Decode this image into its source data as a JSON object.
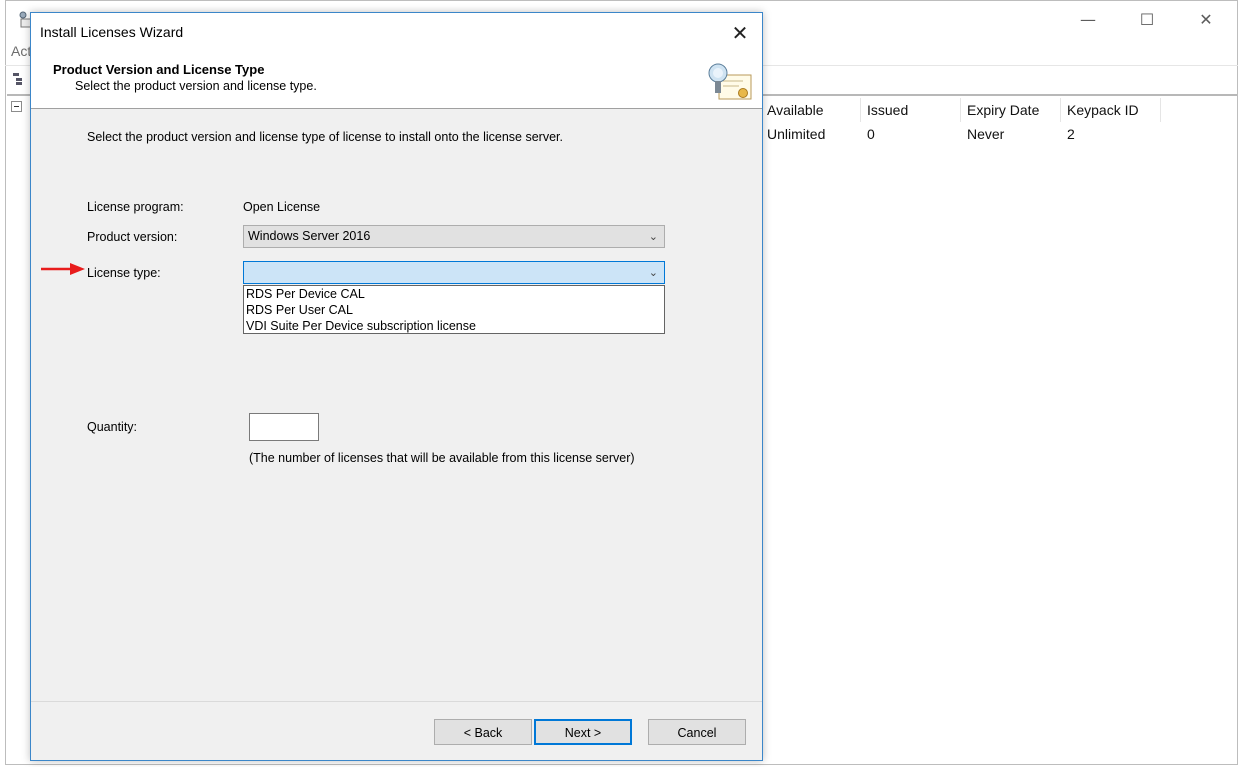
{
  "background_window": {
    "menu_partial": "Act",
    "controls": {
      "minimize": "—",
      "maximize": "☐",
      "close": "✕"
    },
    "columns": [
      "Available",
      "Issued",
      "Expiry Date",
      "Keypack ID"
    ],
    "row": [
      "Unlimited",
      "0",
      "Never",
      "2"
    ]
  },
  "dialog": {
    "title": "Install Licenses Wizard",
    "close_glyph": "✕",
    "header": {
      "title": "Product Version and License Type",
      "subtitle": "Select the product version and license type."
    },
    "intro": "Select the product version and license type of license to install onto the license server.",
    "fields": {
      "program_label": "License program:",
      "program_value": "Open License",
      "version_label": "Product version:",
      "version_value": "Windows Server 2016",
      "type_label": "License type:",
      "type_value": "",
      "type_options": [
        "RDS Per Device CAL",
        "RDS Per User CAL",
        "VDI Suite Per Device subscription license"
      ],
      "quantity_label": "Quantity:",
      "quantity_value": "",
      "quantity_note": "(The number of licenses that will be available from this license server)"
    },
    "buttons": {
      "back": "< Back",
      "next": "Next >",
      "cancel": "Cancel"
    }
  },
  "colors": {
    "accent": "#0078d7",
    "arrow": "#e81c1c",
    "dialog_bg": "#f0f0f0"
  },
  "icons": [
    "license-server-icon",
    "certificate-icon",
    "chevron-down-icon",
    "close-icon",
    "red-arrow-icon"
  ]
}
